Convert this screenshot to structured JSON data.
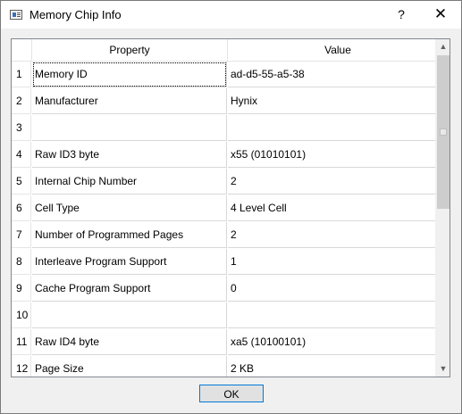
{
  "window": {
    "title": "Memory Chip Info",
    "help_label": "?",
    "close_label": "✕"
  },
  "table": {
    "headers": {
      "property": "Property",
      "value": "Value"
    },
    "rows": [
      {
        "index": "1",
        "property": "Memory ID",
        "value": "ad-d5-55-a5-38"
      },
      {
        "index": "2",
        "property": "Manufacturer",
        "value": "Hynix"
      },
      {
        "index": "3",
        "property": "",
        "value": ""
      },
      {
        "index": "4",
        "property": "Raw ID3 byte",
        "value": "x55 (01010101)"
      },
      {
        "index": "5",
        "property": "Internal Chip Number",
        "value": "2"
      },
      {
        "index": "6",
        "property": "Cell Type",
        "value": "4 Level Cell"
      },
      {
        "index": "7",
        "property": "Number of Programmed Pages",
        "value": "2"
      },
      {
        "index": "8",
        "property": "Interleave Program Support",
        "value": "1"
      },
      {
        "index": "9",
        "property": "Cache Program Support",
        "value": "0"
      },
      {
        "index": "10",
        "property": "",
        "value": ""
      },
      {
        "index": "11",
        "property": "Raw ID4 byte",
        "value": "xa5 (10100101)"
      },
      {
        "index": "12",
        "property": "Page Size",
        "value": "2 KB"
      }
    ]
  },
  "buttons": {
    "ok": "OK"
  }
}
